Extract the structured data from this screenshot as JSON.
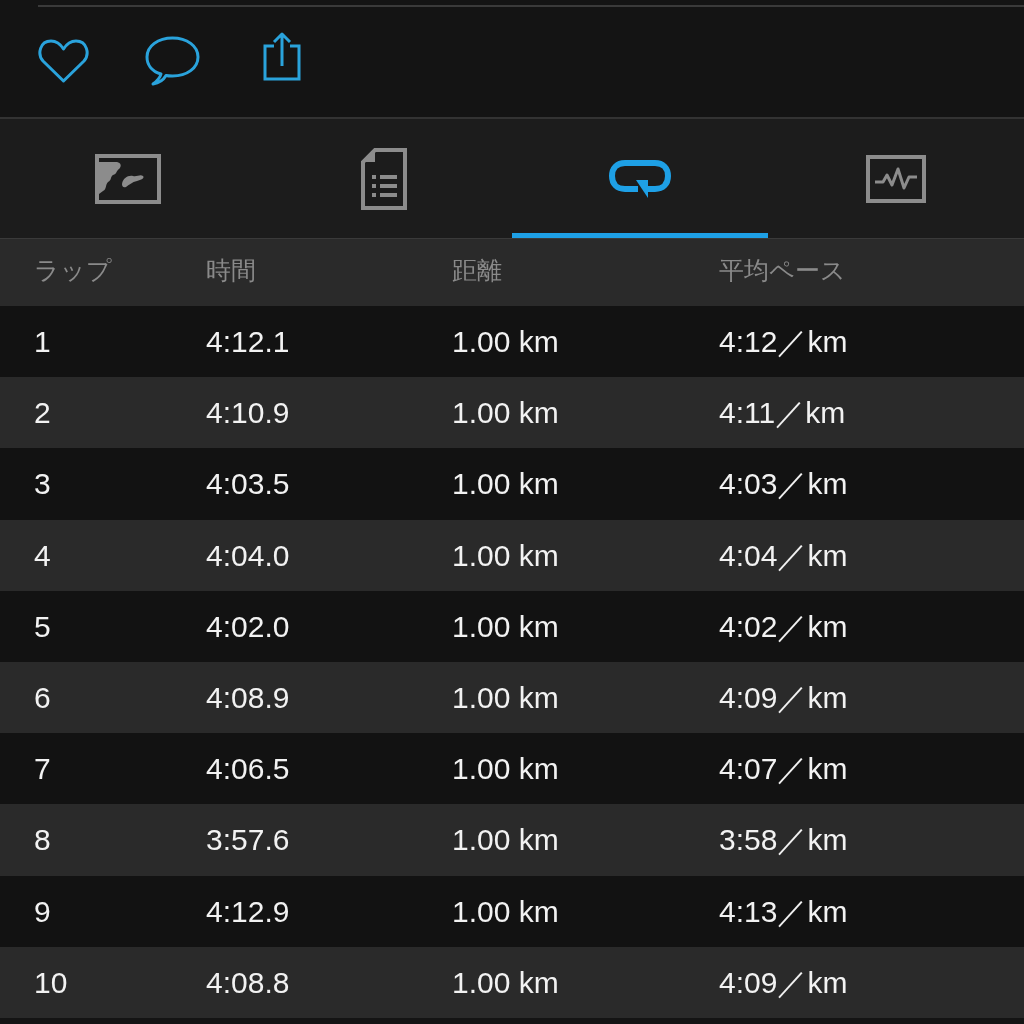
{
  "tabs": [
    {
      "kind": "map",
      "selected": false
    },
    {
      "kind": "summary",
      "selected": false
    },
    {
      "kind": "laps",
      "selected": true
    },
    {
      "kind": "chart",
      "selected": false
    }
  ],
  "table": {
    "columns": [
      "ラップ",
      "時間",
      "距離",
      "平均ペース"
    ],
    "rows": [
      [
        "1",
        "4:12.1",
        "1.00 km",
        "4:12／km"
      ],
      [
        "2",
        "4:10.9",
        "1.00 km",
        "4:11／km"
      ],
      [
        "3",
        "4:03.5",
        "1.00 km",
        "4:03／km"
      ],
      [
        "4",
        "4:04.0",
        "1.00 km",
        "4:04／km"
      ],
      [
        "5",
        "4:02.0",
        "1.00 km",
        "4:02／km"
      ],
      [
        "6",
        "4:08.9",
        "1.00 km",
        "4:09／km"
      ],
      [
        "7",
        "4:06.5",
        "1.00 km",
        "4:07／km"
      ],
      [
        "8",
        "3:57.6",
        "1.00 km",
        "3:58／km"
      ],
      [
        "9",
        "4:12.9",
        "1.00 km",
        "4:13／km"
      ],
      [
        "10",
        "4:08.8",
        "1.00 km",
        "4:09／km"
      ]
    ]
  }
}
